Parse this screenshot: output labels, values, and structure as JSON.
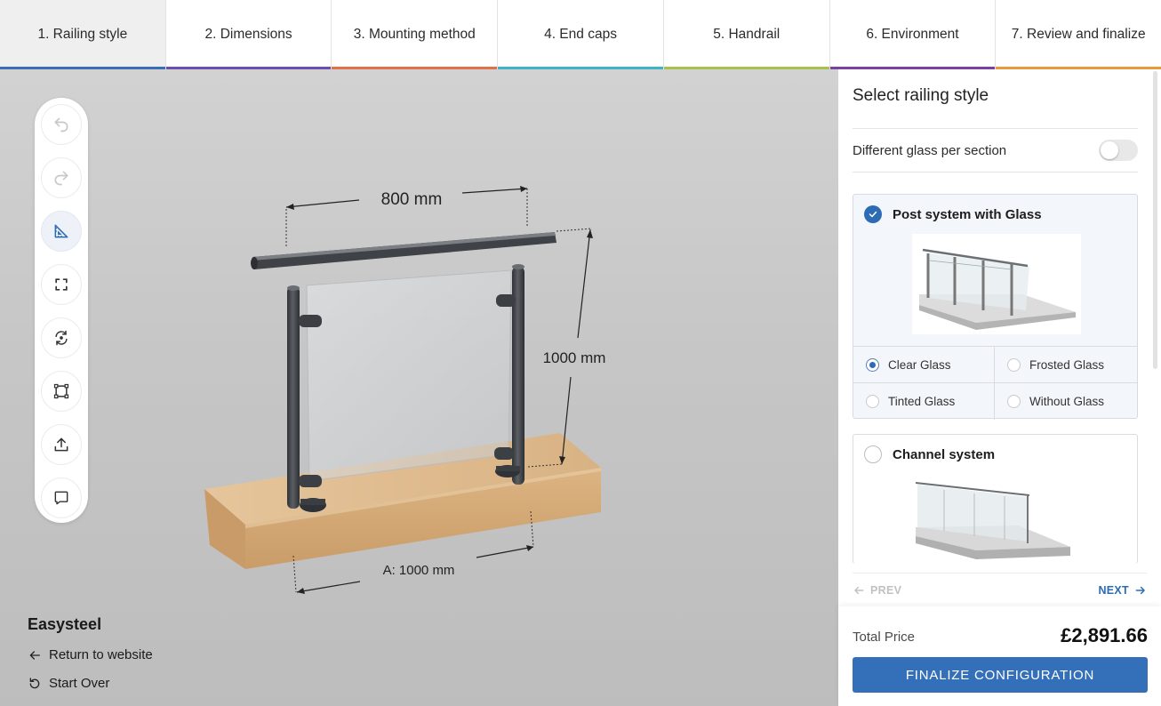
{
  "tabs": [
    {
      "label": "1. Railing style",
      "color": "#3a6fb7",
      "active": true
    },
    {
      "label": "2. Dimensions",
      "color": "#6a4fb0"
    },
    {
      "label": "3. Mounting method",
      "color": "#e2714a"
    },
    {
      "label": "4. End caps",
      "color": "#3fb4c8"
    },
    {
      "label": "5. Handrail",
      "color": "#a6c24a"
    },
    {
      "label": "6. Environment",
      "color": "#7a3fa0"
    },
    {
      "label": "7. Review and finalize",
      "color": "#e89a3a"
    }
  ],
  "viewer": {
    "dimension_width": "800 mm",
    "dimension_height": "1000 mm",
    "dimension_section": "A: 1000 mm",
    "tools": [
      {
        "icon": "undo-icon",
        "active": false
      },
      {
        "icon": "redo-icon",
        "active": false
      },
      {
        "icon": "measure-icon",
        "active": true
      },
      {
        "icon": "fullscreen-icon",
        "active": false
      },
      {
        "icon": "rotate-view-icon",
        "active": false
      },
      {
        "icon": "frame-select-icon",
        "active": false
      },
      {
        "icon": "share-icon",
        "active": false
      },
      {
        "icon": "comment-icon",
        "active": false
      }
    ]
  },
  "brand": "Easysteel",
  "links": {
    "return": "Return to website",
    "start_over": "Start Over"
  },
  "panel": {
    "title": "Select railing style",
    "toggle_label": "Different glass per section",
    "toggle_on": false,
    "cards": [
      {
        "title": "Post system with Glass",
        "selected": true,
        "options": [
          {
            "label": "Clear Glass",
            "selected": true
          },
          {
            "label": "Frosted Glass",
            "selected": false
          },
          {
            "label": "Tinted Glass",
            "selected": false
          },
          {
            "label": "Without Glass",
            "selected": false
          }
        ]
      },
      {
        "title": "Channel system",
        "selected": false
      }
    ],
    "prev_label": "PREV",
    "next_label": "NEXT"
  },
  "footer": {
    "price_label": "Total Price",
    "price_value": "£2,891.66",
    "finalize_label": "FINALIZE CONFIGURATION"
  },
  "colors": {
    "accent": "#3470b9",
    "wood": "#d9b486",
    "metal": "#4a4d52"
  }
}
